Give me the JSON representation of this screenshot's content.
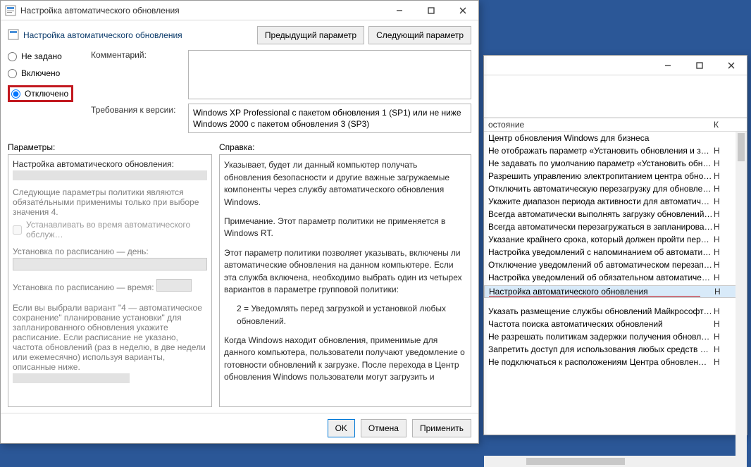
{
  "dialog": {
    "title": "Настройка автоматического обновления",
    "subtitle": "Настройка автоматического обновления",
    "prev_btn": "Предыдущий параметр",
    "next_btn": "Следующий параметр",
    "radio_notset": "Не задано",
    "radio_enabled": "Включено",
    "radio_disabled": "Отключено",
    "comment_label": "Комментарий:",
    "req_label": "Требования к версии:",
    "req_text": "Windows XP Professional с пакетом обновления 1 (SP1) или не ниже Windows 2000 с пакетом обновления 3 (SP3)",
    "params_label": "Параметры:",
    "help_label": "Справка:",
    "params": {
      "heading": "Настройка автоматического обновления:",
      "note": "Следующие параметры политики являются обязате́льными применимы только при выборе значения 4.",
      "checkbox": "Устанавливать во время автоматического обслуж…",
      "day_label": "Установка по расписанию — день:",
      "time_label": "Установка по расписанию — время:",
      "tail": "Если вы выбрали вариант \"4 — автоматическое сохранение\" планирование установки\" для запланированного обновления укажите расписание. Если расписание не указано, частота обновлений (раз в неделю, в две недели или ежемесячно) используя варианты, описанные ниже."
    },
    "help_paragraphs": [
      "Указывает, будет ли данный компьютер получать обновления безопасности и другие важные загружаемые компоненты через службу автоматического обновления Windows.",
      "Примечание. Этот параметр политики не применяется в Windows RT.",
      "Этот параметр политики позволяет указывать, включены ли автоматические обновления на данном компьютере. Если эта служба включена, необходимо выбрать один из четырех вариантов в параметре групповой политики:",
      "2 = Уведомлять перед загрузкой и установкой любых обновлений.",
      "Когда Windows находит обновления, применимые для данного компьютера, пользователи получают уведомление о готовности обновлений к загрузке. После перехода в Центр обновления Windows пользователи могут загрузить и"
    ],
    "ok": "OK",
    "cancel": "Отмена",
    "apply": "Применить"
  },
  "list": {
    "col_state": "остояние",
    "col_k": "К",
    "rows": [
      {
        "name": "Центр обновления Windows для бизнеса",
        "state": ""
      },
      {
        "name": "Не отображать параметр «Установить обновления и завер…",
        "state": "Н"
      },
      {
        "name": "Не задавать по умолчанию параметр «Установить обнов…",
        "state": "Н"
      },
      {
        "name": "Разрешить управлению электропитанием центра обнов…",
        "state": "Н"
      },
      {
        "name": "Отключить автоматическую перезагрузку для обновлен…",
        "state": "Н"
      },
      {
        "name": "Укажите диапазон периода активности для автоматичес…",
        "state": "Н"
      },
      {
        "name": "Всегда автоматически выполнять загрузку обновлений через …",
        "state": "Н"
      },
      {
        "name": "Всегда автоматически перезагружаться в запланирован…",
        "state": "Н"
      },
      {
        "name": "Указание крайнего срока, который должен пройти перед…",
        "state": "Н"
      },
      {
        "name": "Настройка уведомлений с напоминанием об автоматиче…",
        "state": "Н"
      },
      {
        "name": "Отключение уведомлений об автоматическом перезапу…",
        "state": "Н"
      },
      {
        "name": "Настройка уведомлений об обязательном автоматическ…",
        "state": "Н"
      },
      {
        "name": "Настройка автоматического обновления",
        "state": "Н",
        "highlight": true
      },
      {
        "name": "Указать размещение службы обновлений Майкрософт в…",
        "state": "Н"
      },
      {
        "name": "Частота поиска автоматических обновлений",
        "state": "Н"
      },
      {
        "name": "Не разрешать политикам задержки получения обновлен…",
        "state": "Н"
      },
      {
        "name": "Запретить доступ для использования любых средств Цен…",
        "state": "Н"
      },
      {
        "name": "Не подключаться к расположениям Центра обновлен…",
        "state": "Н"
      }
    ]
  },
  "watermark": ""
}
